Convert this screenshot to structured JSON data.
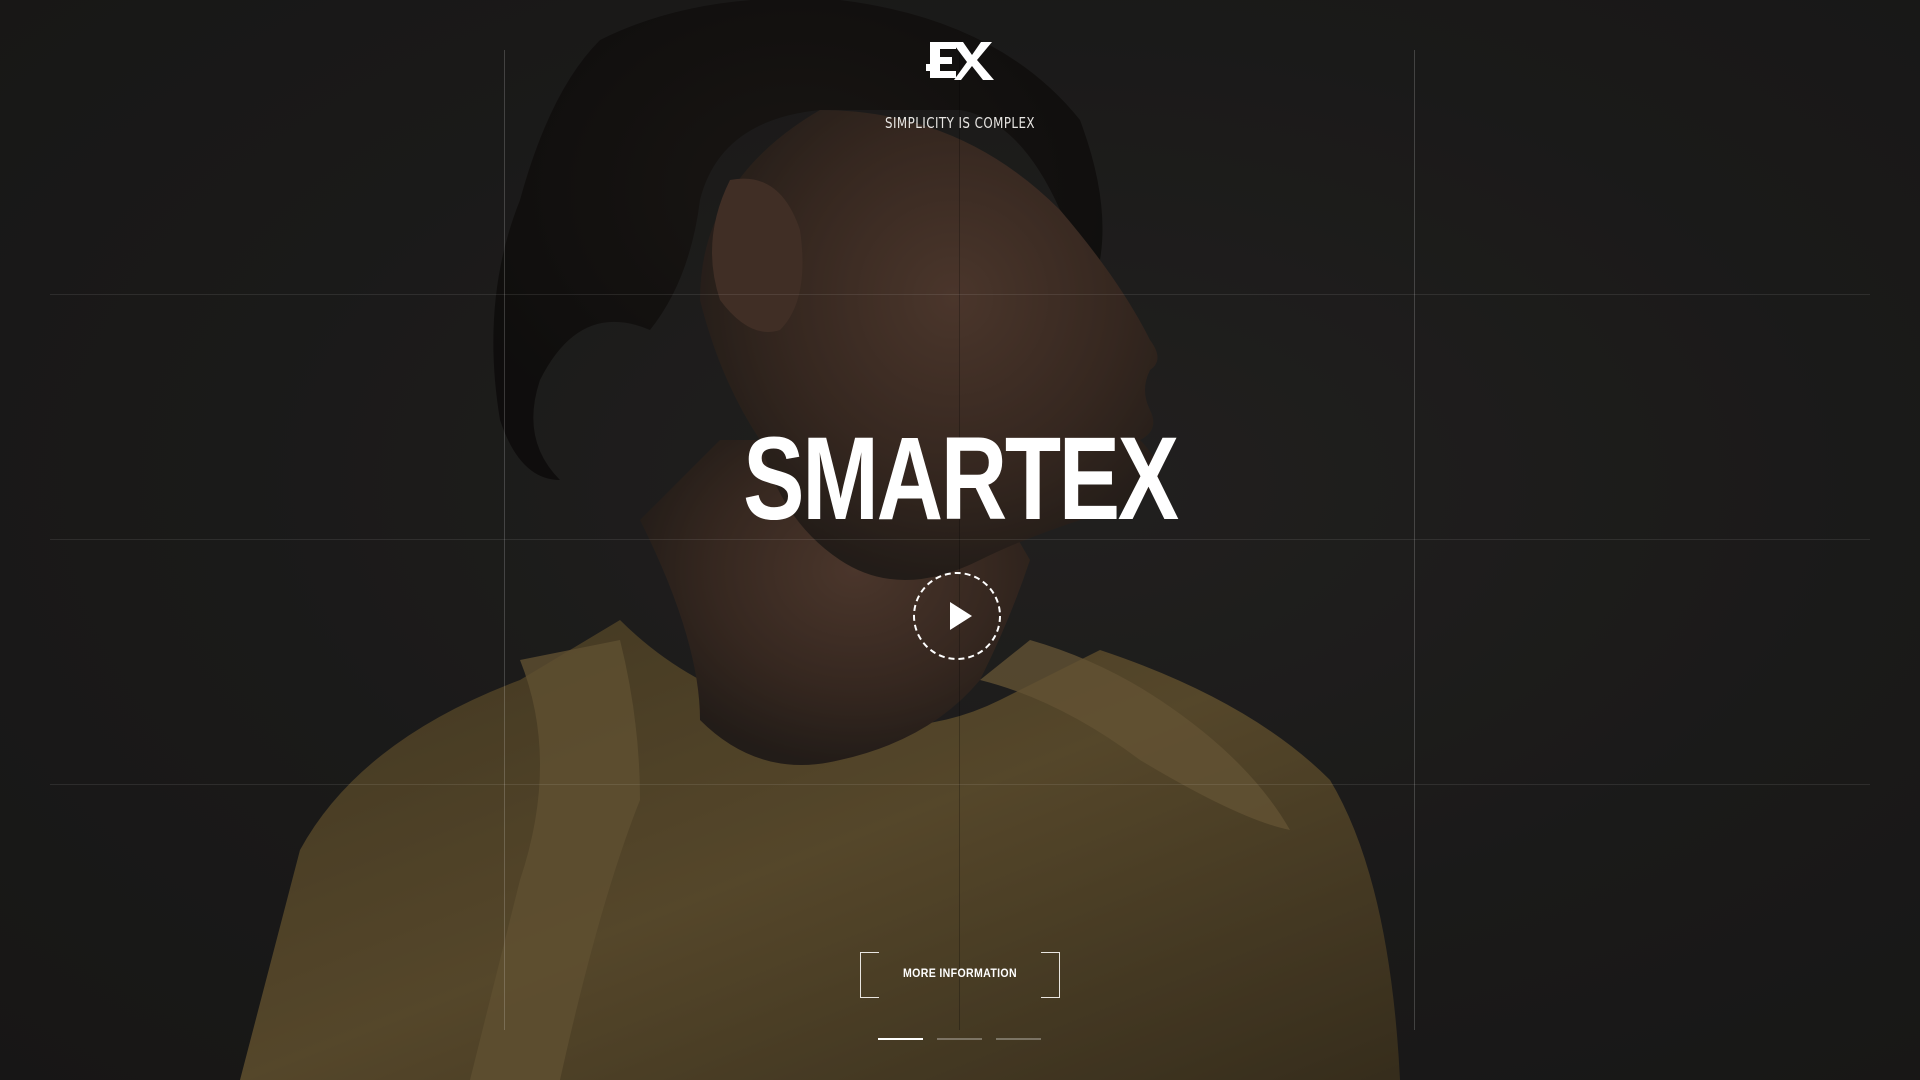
{
  "brand": {
    "logo_icon": "ex-logo-icon",
    "tagline": "SIMPLICITY IS COMPLEX",
    "title": "SMARTEX"
  },
  "hero": {
    "play_icon": "play-icon",
    "cta_label": "MORE INFORMATION",
    "active_slide": 1,
    "slide_count": 3
  },
  "colors": {
    "background": "#1f1e1d",
    "text": "#ffffff",
    "jacket": "#6e5a32"
  }
}
